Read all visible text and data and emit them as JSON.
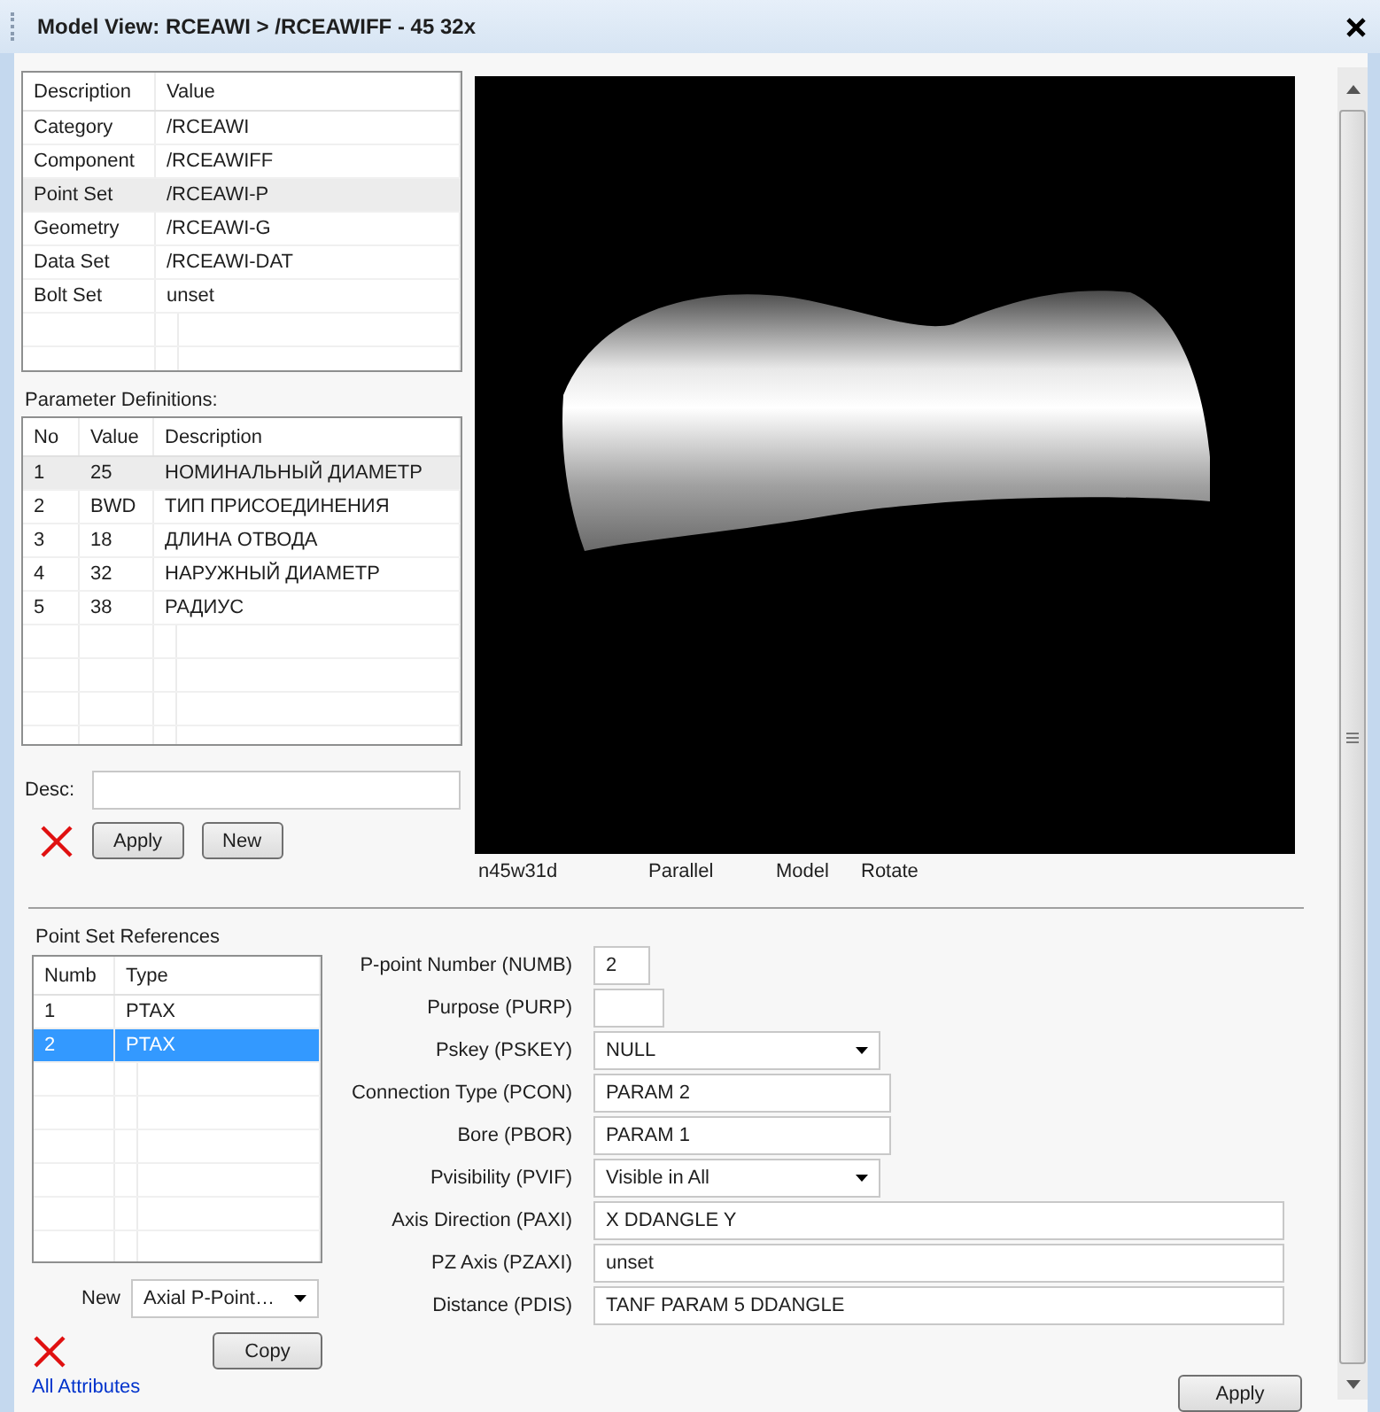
{
  "window": {
    "title": "Model View: RCEAWI > /RCEAWIFF - 45 32x"
  },
  "model_references": {
    "columns": [
      "Description",
      "Value"
    ],
    "focused": false,
    "rows": [
      {
        "cells": [
          "Category",
          "/RCEAWI"
        ],
        "selected": false
      },
      {
        "cells": [
          "Component",
          "/RCEAWIFF"
        ],
        "selected": false
      },
      {
        "cells": [
          "Point Set",
          "/RCEAWI-P"
        ],
        "selected": true
      },
      {
        "cells": [
          "Geometry",
          "/RCEAWI-G"
        ],
        "selected": false
      },
      {
        "cells": [
          "Data Set",
          "/RCEAWI-DAT"
        ],
        "selected": false
      },
      {
        "cells": [
          "Bolt Set",
          "unset"
        ],
        "selected": false
      }
    ]
  },
  "parameter_definitions": {
    "label": "Parameter Definitions:",
    "columns": [
      "No",
      "Value",
      "Description"
    ],
    "focused": false,
    "rows": [
      {
        "cells": [
          "1",
          "25",
          "НОМИНАЛЬНЫЙ ДИАМЕТР"
        ],
        "selected": true
      },
      {
        "cells": [
          "2",
          "BWD",
          "ТИП ПРИСОЕДИНЕНИЯ"
        ],
        "selected": false
      },
      {
        "cells": [
          "3",
          "18",
          "ДЛИНА ОТВОДА"
        ],
        "selected": false
      },
      {
        "cells": [
          "4",
          "32",
          "НАРУЖНЫЙ ДИАМЕТР"
        ],
        "selected": false
      },
      {
        "cells": [
          "5",
          "38",
          "РАДИУС"
        ],
        "selected": false
      }
    ]
  },
  "desc": {
    "label": "Desc:"
  },
  "parameter_buttons": [
    "Apply",
    "New"
  ],
  "viewer": {
    "status": [
      "n45w31d",
      "Parallel",
      "Model",
      "Rotate"
    ]
  },
  "point_set_references": {
    "label": "Point Set References",
    "columns": [
      "Numb",
      "Type"
    ],
    "focused": true,
    "rows": [
      {
        "cells": [
          "1",
          "PTAX"
        ],
        "selected": false
      },
      {
        "cells": [
          "2",
          "PTAX"
        ],
        "selected": true
      }
    ]
  },
  "new_point": {
    "label": "New",
    "value": "Axial P-Point…"
  },
  "copy_button": "Copy",
  "all_attributes_link": "All Attributes",
  "point_fields": [
    {
      "label": "P-point Number (NUMB)",
      "kind": "text",
      "value": "2"
    },
    {
      "label": "Purpose (PURP)",
      "kind": "text"
    },
    {
      "label": "Pskey (PSKEY)",
      "kind": "select",
      "value": "NULL"
    },
    {
      "label": "Connection Type (PCON)",
      "kind": "text",
      "value": "PARAM 2"
    },
    {
      "label": "Bore (PBOR)",
      "kind": "text",
      "value": "PARAM 1"
    },
    {
      "label": "Pvisibility (PVIF)",
      "kind": "select",
      "value": "Visible in All"
    },
    {
      "label": "Axis Direction (PAXI)",
      "kind": "text",
      "value": "X DDANGLE Y"
    },
    {
      "label": "PZ Axis (PZAXI)",
      "kind": "text",
      "value": "unset"
    },
    {
      "label": "Distance (PDIS)",
      "kind": "text",
      "value": "TANF PARAM 5 DDANGLE"
    }
  ],
  "apply_button": "Apply"
}
